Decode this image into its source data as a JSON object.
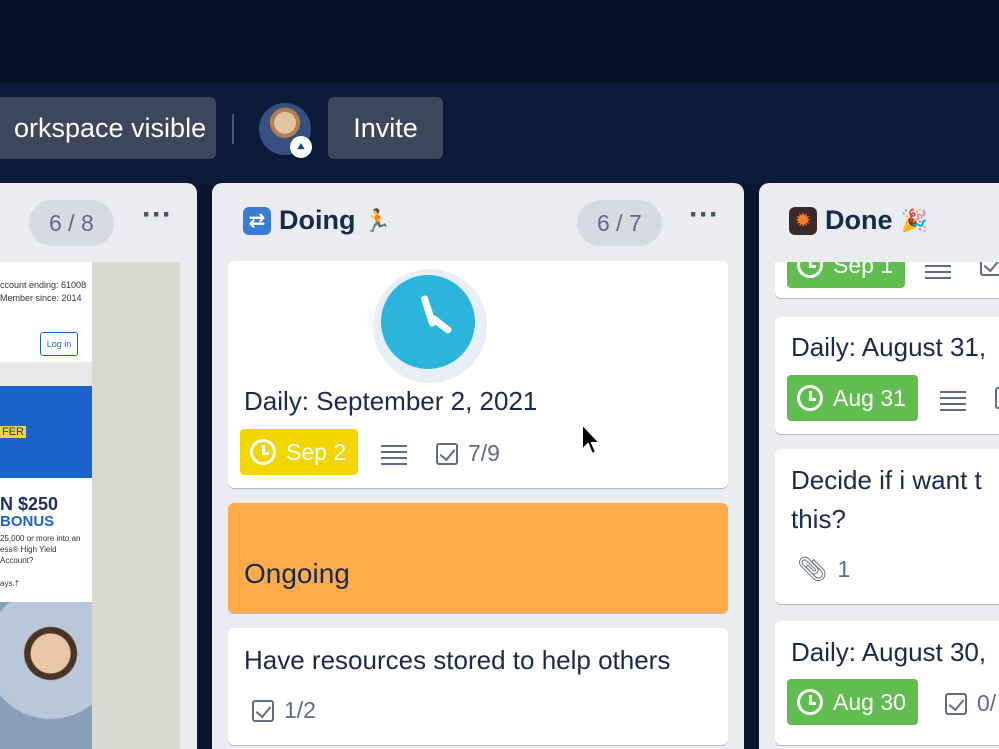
{
  "header": {
    "visibility_label": "orkspace visible",
    "invite_label": "Invite"
  },
  "lists": {
    "left": {
      "count": "6 / 8",
      "menu": "···",
      "ad": {
        "line1": "ccount ending: 61008",
        "line2": "Member since: 2014",
        "login": "Log in",
        "offer": "FER",
        "amount": "N $250",
        "bonus": "BONUS",
        "fine1": "25,000 or more into an",
        "fine2": "ess® High Yield",
        "fine3": "Account?",
        "fine4": "ays.†"
      }
    },
    "doing": {
      "title": "Doing",
      "count": "6 / 7",
      "menu": "···",
      "cards": [
        {
          "title": "Daily: September 2, 2021",
          "due": "Sep 2",
          "checklist": "7/9"
        },
        {
          "title": "Ongoing"
        },
        {
          "title": "Have resources stored to help others",
          "checklist": "1/2"
        }
      ]
    },
    "done": {
      "title": "Done",
      "cards": [
        {
          "due": "Sep 1"
        },
        {
          "title": "Daily: August 31,",
          "due": "Aug 31"
        },
        {
          "title_line1": "Decide if i want t",
          "title_line2": "this?",
          "attachments": "1"
        },
        {
          "title": "Daily: August 30,",
          "due": "Aug 30",
          "checklist": "0/"
        }
      ]
    }
  },
  "colors": {
    "due_yellow": "#f2d600",
    "due_green": "#61bd4f",
    "cover_orange": "#ffab4a",
    "board_bg": "#0a1630"
  }
}
